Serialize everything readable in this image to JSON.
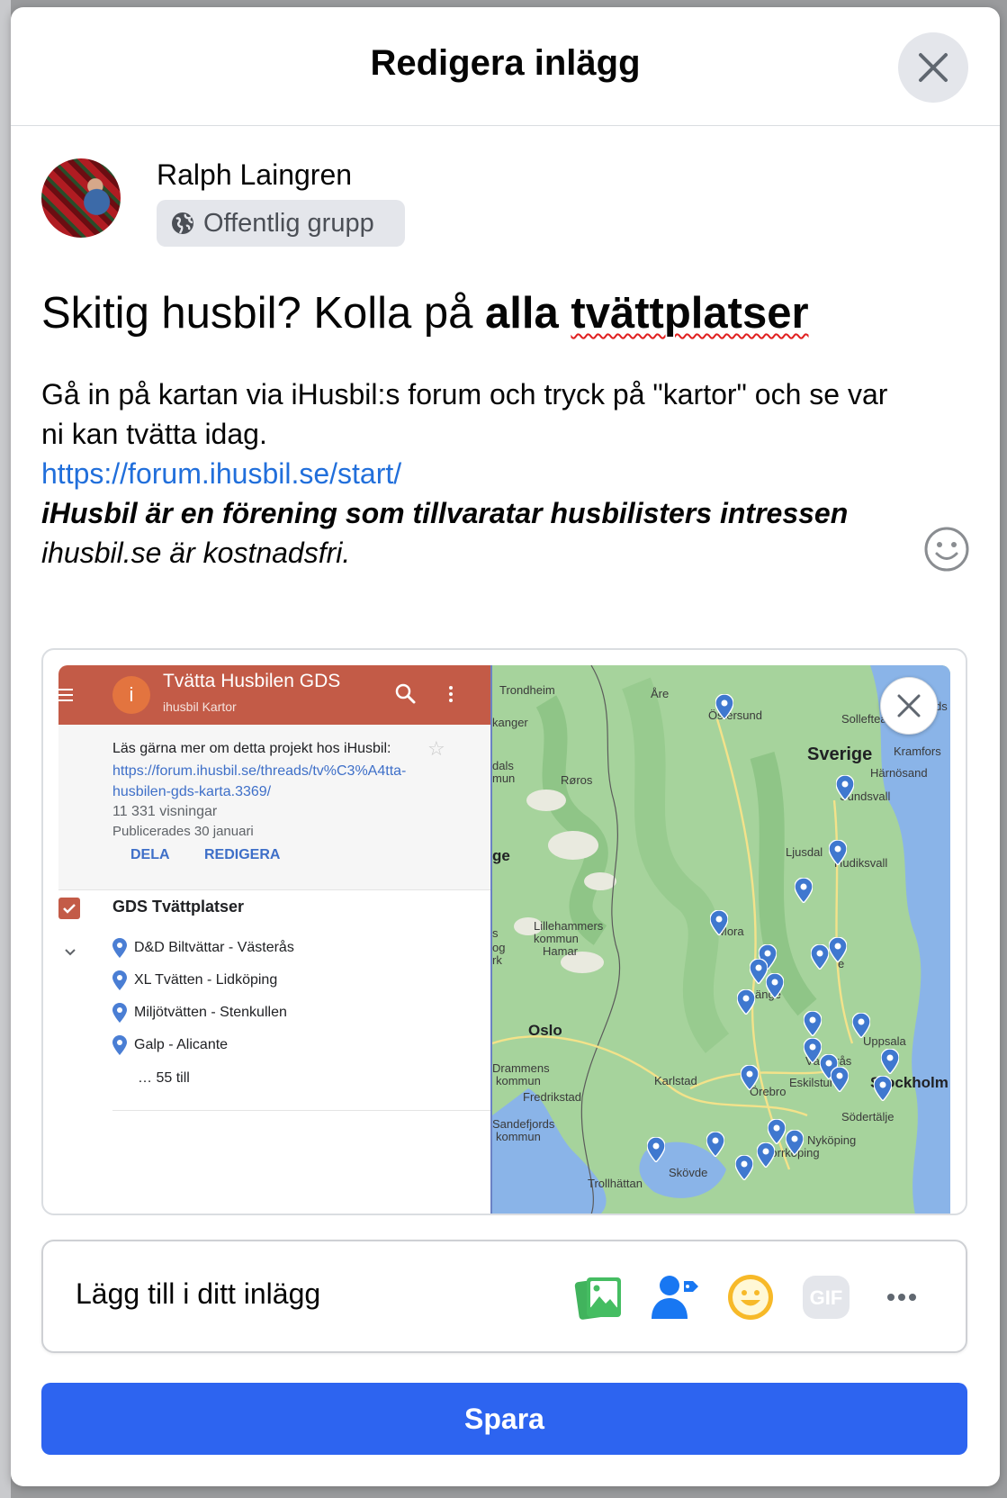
{
  "dialog": {
    "title": "Redigera inlägg"
  },
  "author": {
    "name": "Ralph Laingren",
    "audience": "Offentlig grupp"
  },
  "post": {
    "title_plain": "Skitig husbil? Kolla på ",
    "title_bold": "alla ",
    "title_misspelled": "tvättplatser",
    "line1": "Gå in på kartan via iHusbil:s forum och tryck på \"kartor\" och se var",
    "line2": "ni kan tvätta idag.",
    "link": "https://forum.ihusbil.se/start/",
    "bold_italic": "iHusbil är en förening som tillvaratar husbilisters intressen",
    "italic": "ihusbil.se är kostnadsfri."
  },
  "map_panel": {
    "title": "Tvätta Husbilen GDS",
    "subtitle": "ihusbil Kartor",
    "avatar_letter": "i",
    "info_text": "Läs gärna mer om detta projekt hos iHusbil:",
    "info_link": "https://forum.ihusbil.se/threads/tv%C3%A4tta-husbilen-gds-karta.3369/",
    "views": "11 331 visningar",
    "published": "Publicerades 30 januari",
    "share": "DELA",
    "edit": "REDIGERA",
    "layer": "GDS Tvättplatser",
    "places": [
      "D&D Biltvättar - Västerås",
      "XL Tvätten - Lidköping",
      "Miljötvätten - Stenkullen",
      "Galp - Alicante"
    ],
    "more": "… 55 till"
  },
  "map_labels": {
    "trondheim": "Trondheim",
    "kanger": "kanger",
    "are": "Åre",
    "ostersund": "Östersund",
    "solleftea": "Sollefteå",
    "ds": "ds",
    "sverige": "Sverige",
    "kramfors": "Kramfors",
    "harnosand": "Härnösand",
    "dals": "dals",
    "mun": "mun",
    "roros": "Røros",
    "sundsvall": "Sundsvall",
    "ljusdal": "Ljusdal",
    "hudiksvall": "Hudiksvall",
    "ge": "ge",
    "lillehammer1": "Lillehammers",
    "lillehammer2": "kommun",
    "s": "s",
    "og": "og",
    "rk": "rk",
    "hamar": "Hamar",
    "mora": "Mora",
    "gavle": "e",
    "ange": "änge",
    "oslo": "Oslo",
    "uppsala": "Uppsala",
    "vasteras": "Västerås",
    "drammens1": "Drammens",
    "drammens2": "kommun",
    "karlstad": "Karlstad",
    "eskilstuna": "Eskilstuna",
    "stockholm": "Stockholm",
    "orebro": "Örebro",
    "fredrikstad": "Fredrikstad",
    "sodertalje": "Södertälje",
    "sandefjord1": "Sandefjords",
    "sandefjord2": "kommun",
    "nykoping": "Nyköping",
    "norrkoping": "Norrköping",
    "skovde": "Skövde",
    "trollhattan": "Trollhättan"
  },
  "composer": {
    "add_label": "Lägg till i ditt inlägg",
    "tools": [
      "photo-video-icon",
      "tag-people-icon",
      "feeling-icon",
      "gif-icon",
      "more-icon"
    ]
  },
  "save_button": "Spara",
  "colors": {
    "primary": "#2d64f0",
    "link": "#216fdb",
    "map_header": "#c35b47"
  }
}
